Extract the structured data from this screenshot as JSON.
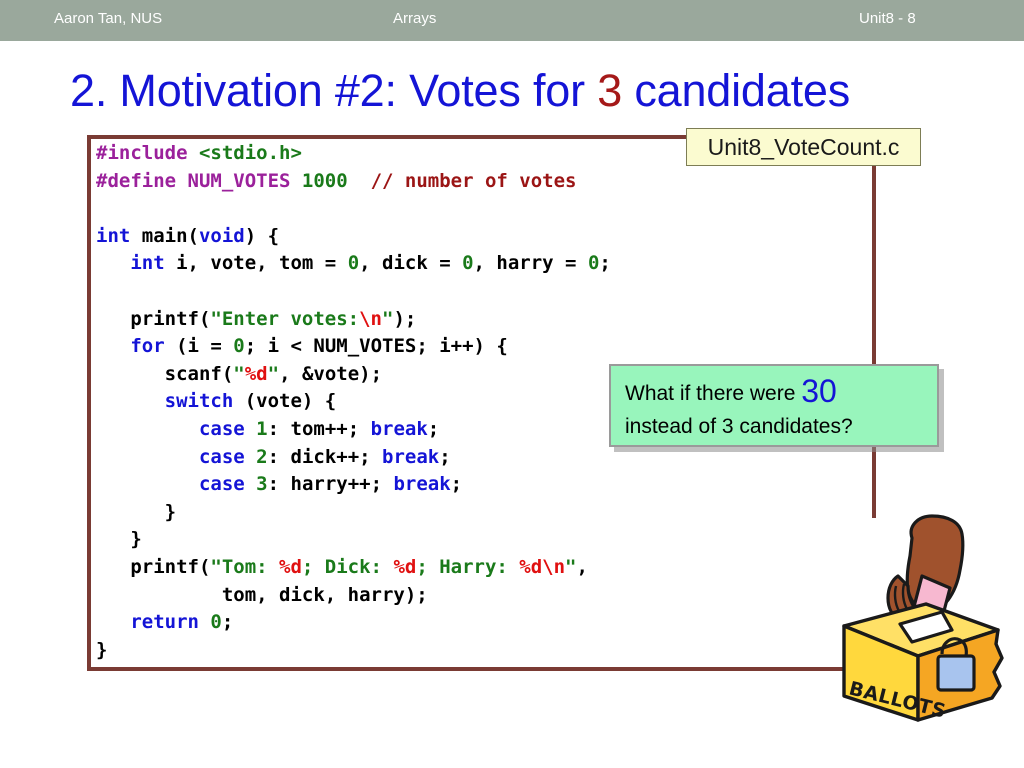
{
  "header": {
    "author": "Aaron Tan, NUS",
    "topic": "Arrays",
    "unit": "Unit8 - 8",
    "background_color": "#9aa89c",
    "text_color": "#ffffff"
  },
  "title": {
    "prefix": "2. Motivation #2: Votes for ",
    "accent": "3",
    "suffix": " candidates",
    "color": "#1414d6",
    "accent_color": "#a51919"
  },
  "filename_callout": {
    "label": "Unit8_VoteCount.c",
    "background_color": "#fbfbd0",
    "border_color": "#7d7d55"
  },
  "question_callout": {
    "line1_before": "What if there were ",
    "line1_number": "30",
    "line2": "instead of 3 candidates?",
    "background_color": "#98f5bc",
    "number_color": "#1414d6",
    "border_color": "#9a9a9a"
  },
  "code": {
    "language": "C",
    "frame_color": "#7a3b34",
    "colors": {
      "keyword": "#1414d6",
      "preprocessor": "#9b219b",
      "number": "#1a7a1a",
      "string": "#1a7a1a",
      "escape": "#e01010",
      "comment": "#9b1515",
      "plain": "#000000"
    },
    "lines": [
      "#include <stdio.h>",
      "#define NUM_VOTES 1000  // number of votes",
      "",
      "int main(void) {",
      "   int i, vote, tom = 0, dick = 0, harry = 0;",
      "",
      "   printf(\"Enter votes:\\n\");",
      "   for (i = 0; i < NUM_VOTES; i++) {",
      "      scanf(\"%d\", &vote);",
      "      switch (vote) {",
      "         case 1: tom++; break;",
      "         case 2: dick++; break;",
      "         case 3: harry++; break;",
      "      }",
      "   }",
      "   printf(\"Tom: %d; Dick: %d; Harry: %d\\n\",",
      "           tom, dick, harry);",
      "   return 0;",
      "}"
    ]
  },
  "ballot_art": {
    "label": "BALLOTS",
    "box_color": "#ffd83d",
    "box_side_color": "#f5a623",
    "hand_color": "#a0522d",
    "ballot_color": "#f7b8d0",
    "lock_color": "#a8c4ee"
  }
}
